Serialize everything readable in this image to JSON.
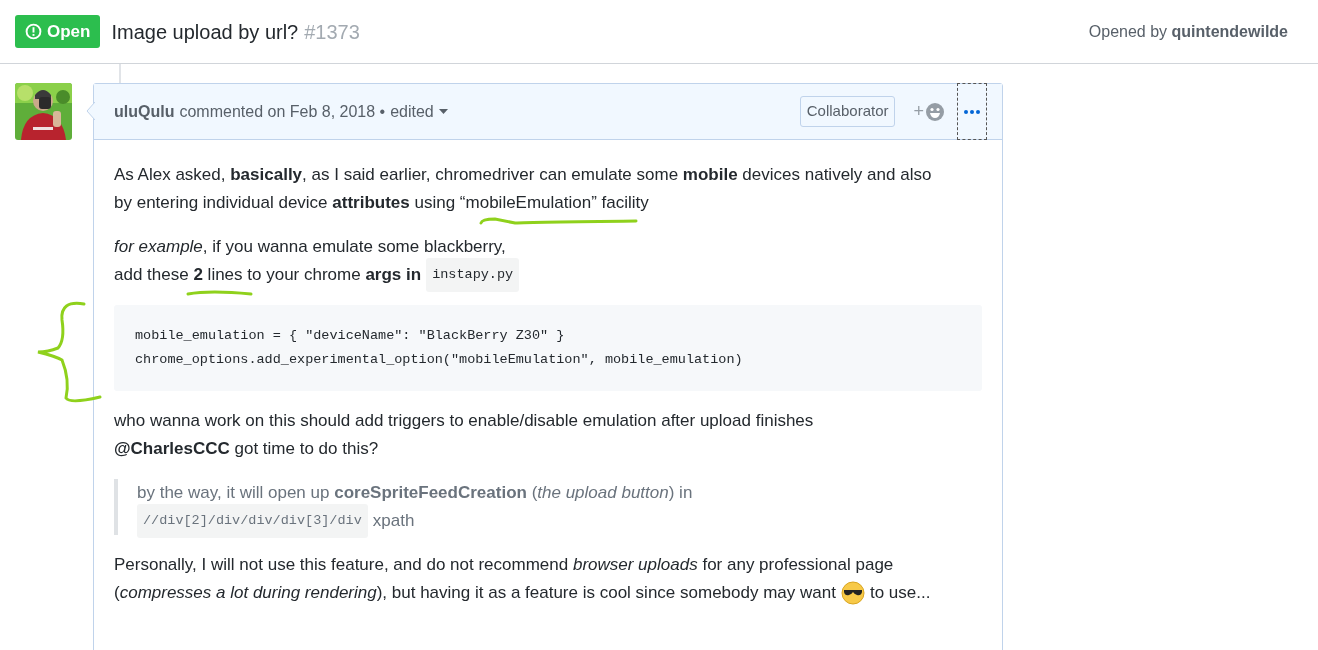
{
  "issue": {
    "state": "Open",
    "title": "Image upload by url?",
    "number": "#1373",
    "opened_by_label": "Opened by",
    "opened_by": "quintendewilde"
  },
  "comment": {
    "author": "uluQulu",
    "meta": "commented on Feb 8, 2018 •",
    "edited": "edited",
    "role": "Collaborator",
    "reaction_plus": "+",
    "blocks": [
      {
        "kind": "para",
        "lines": [
          [
            {
              "kind": "text",
              "text": "As Alex asked, **basically**, as I said earlier, chromedriver can emulate some **mobile** devices natively and also"
            }
          ],
          [
            {
              "kind": "text",
              "text": "by entering individual device **attributes** using “mobileEmulation” facility"
            }
          ]
        ]
      },
      {
        "kind": "para",
        "lines": [
          [
            {
              "kind": "text",
              "text": "*for example*, if you wanna emulate some blackberry,"
            }
          ],
          [
            {
              "kind": "text",
              "text": "add these **2** lines to your chrome **args in**"
            },
            {
              "kind": "code",
              "text": "instapy.py"
            }
          ]
        ]
      },
      {
        "kind": "code",
        "lines": [
          "mobile_emulation = { \"deviceName\": \"BlackBerry Z30\" }",
          "chrome_options.add_experimental_option(\"mobileEmulation\", mobile_emulation)"
        ]
      },
      {
        "kind": "para",
        "lines": [
          [
            {
              "kind": "text",
              "text": "who wanna work on this should add triggers to enable/disable emulation after upload finishes"
            }
          ],
          [
            {
              "kind": "text",
              "text": "**@CharlesCCC** got time to do this?"
            }
          ]
        ]
      },
      {
        "kind": "quote",
        "lines": [
          [
            {
              "kind": "text",
              "text": "by the way, it will open up **coreSpriteFeedCreation** (*the upload button*) in"
            }
          ],
          [
            {
              "kind": "code",
              "text": "//div[2]/div/div/div[3]/div"
            },
            {
              "kind": "text",
              "text": "xpath"
            }
          ]
        ]
      },
      {
        "kind": "para",
        "lines": [
          [
            {
              "kind": "text",
              "text": "Personally, I will not use this feature, and do not recommend *browser uploads* for any professional page"
            }
          ],
          [
            {
              "kind": "text",
              "text": "(*compresses a lot during rendering*), but having it as a feature is cool since somebody may want"
            },
            {
              "kind": "emoji"
            },
            {
              "kind": "text",
              "text": "to use..."
            }
          ]
        ]
      }
    ]
  }
}
